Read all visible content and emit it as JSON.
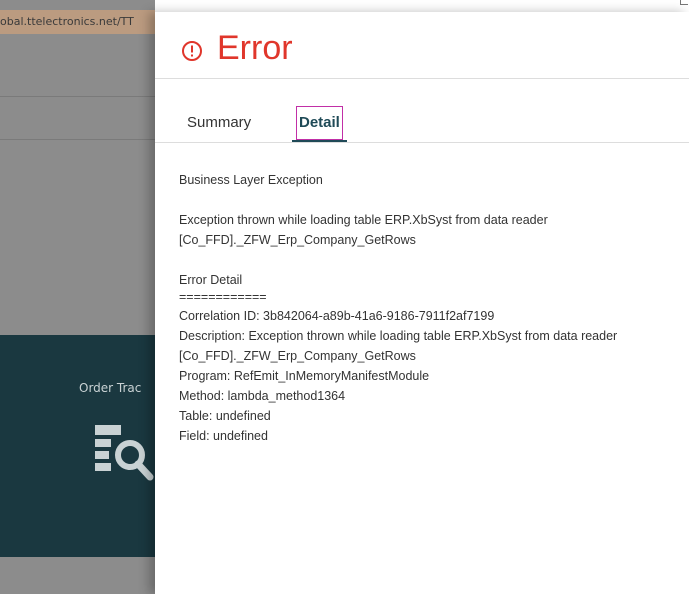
{
  "background": {
    "url_text": "obal.ttelectronics.net/TT",
    "tile_label": "Order Trac",
    "tile_icon": "table-search-icon",
    "tile_color": "#1a3840"
  },
  "dialog": {
    "title": "Error",
    "title_icon": "error-circle-icon",
    "title_color": "#e0362b",
    "tabs": [
      {
        "label": "Summary",
        "active": false
      },
      {
        "label": "Detail",
        "active": true
      }
    ],
    "detail_lines": {
      "layer": "Business Layer Exception",
      "exception_1": "Exception thrown while loading table ERP.XbSyst from data reader",
      "exception_2": "[Co_FFD]._ZFW_Erp_Company_GetRows",
      "error_detail": "Error Detail",
      "separator": "============",
      "correlation": "Correlation ID: 3b842064-a89b-41a6-9186-7911f2af7199",
      "description_1": "Description: Exception thrown while loading table ERP.XbSyst from data reader",
      "description_2": "[Co_FFD]._ZFW_Erp_Company_GetRows",
      "program": "Program: RefEmit_InMemoryManifestModule",
      "method": "Method: lambda_method1364",
      "table": "Table: undefined",
      "field": "Field: undefined"
    }
  }
}
